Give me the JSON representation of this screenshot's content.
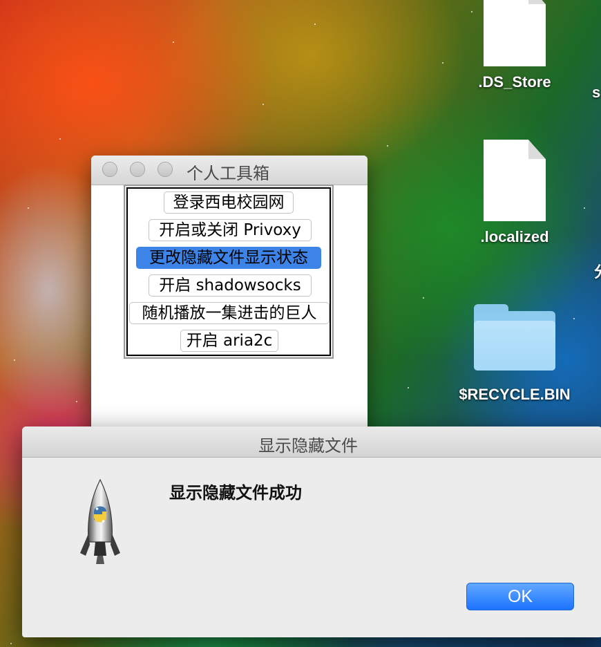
{
  "desktop": {
    "icons": [
      {
        "label": ".DS_Store",
        "icon": "document-icon"
      },
      {
        "label": ".localized",
        "icon": "document-icon"
      },
      {
        "label": "$RECYCLE.BIN",
        "icon": "folder-icon"
      }
    ],
    "edge_text_top": "s",
    "edge_text_mid": "分"
  },
  "tool_window": {
    "title": "个人工具箱",
    "buttons": [
      {
        "label": "登录西电校园网"
      },
      {
        "label": "开启或关闭 Privoxy"
      },
      {
        "label": "更改隐藏文件显示状态",
        "selected": true
      },
      {
        "label": "开启 shadowsocks"
      },
      {
        "label": "随机播放一集进击的巨人"
      },
      {
        "label": "开启 aria2c"
      }
    ]
  },
  "alert": {
    "title": "显示隐藏文件",
    "message": "显示隐藏文件成功",
    "icon": "python-launcher-rocket-icon",
    "ok_label": "OK"
  },
  "colors": {
    "selected_button": "#3d84e8",
    "ok_button": "#1b73ff"
  }
}
